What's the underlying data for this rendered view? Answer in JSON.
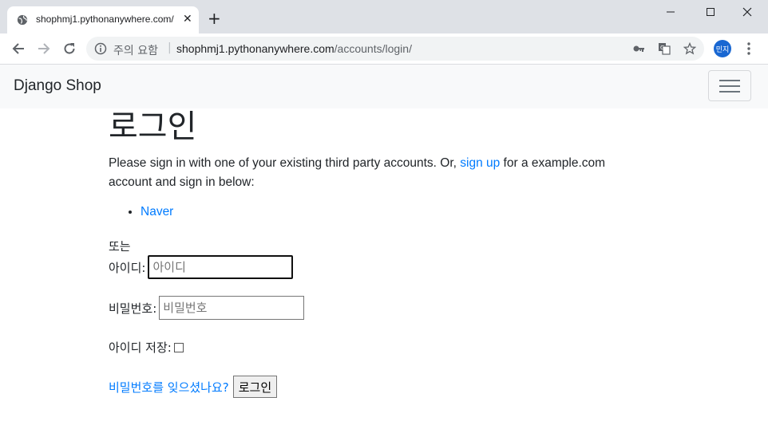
{
  "browser": {
    "tab_title": "shophmj1.pythonanywhere.com/",
    "new_tab_label": "+",
    "tab_close_label": "✕",
    "security_label": "주의 요함",
    "url_separator": "|",
    "url_host": "shophmj1.pythonanywhere.com",
    "url_path": "/accounts/login/",
    "profile_initials": "민지",
    "icons": [
      "globe-icon",
      "back-icon",
      "forward-icon",
      "reload-icon",
      "info-icon",
      "key-icon",
      "translate-icon",
      "star-icon",
      "menu-icon",
      "minimize-icon",
      "maximize-icon",
      "close-icon"
    ]
  },
  "navbar": {
    "brand": "Django Shop"
  },
  "login": {
    "title": "로그인",
    "intro_before": "Please sign in with one of your existing third party accounts. Or, ",
    "signup_link": "sign up",
    "intro_after": " for a example.com account and sign in below:",
    "providers": [
      "Naver"
    ],
    "or_text": "또는",
    "username_label": "아이디:",
    "username_placeholder": "아이디",
    "password_label": "비밀번호:",
    "password_placeholder": "비밀번호",
    "remember_label": "아이디 저장:",
    "remember_checked": false,
    "forgot_link": "비밀번호를 잊으셨나요?",
    "submit_label": "로그인"
  },
  "colors": {
    "link": "#007bff",
    "navbar_bg": "#f8f9fa",
    "tabstrip_bg": "#dee1e6",
    "avatar_bg": "#1967d2"
  }
}
